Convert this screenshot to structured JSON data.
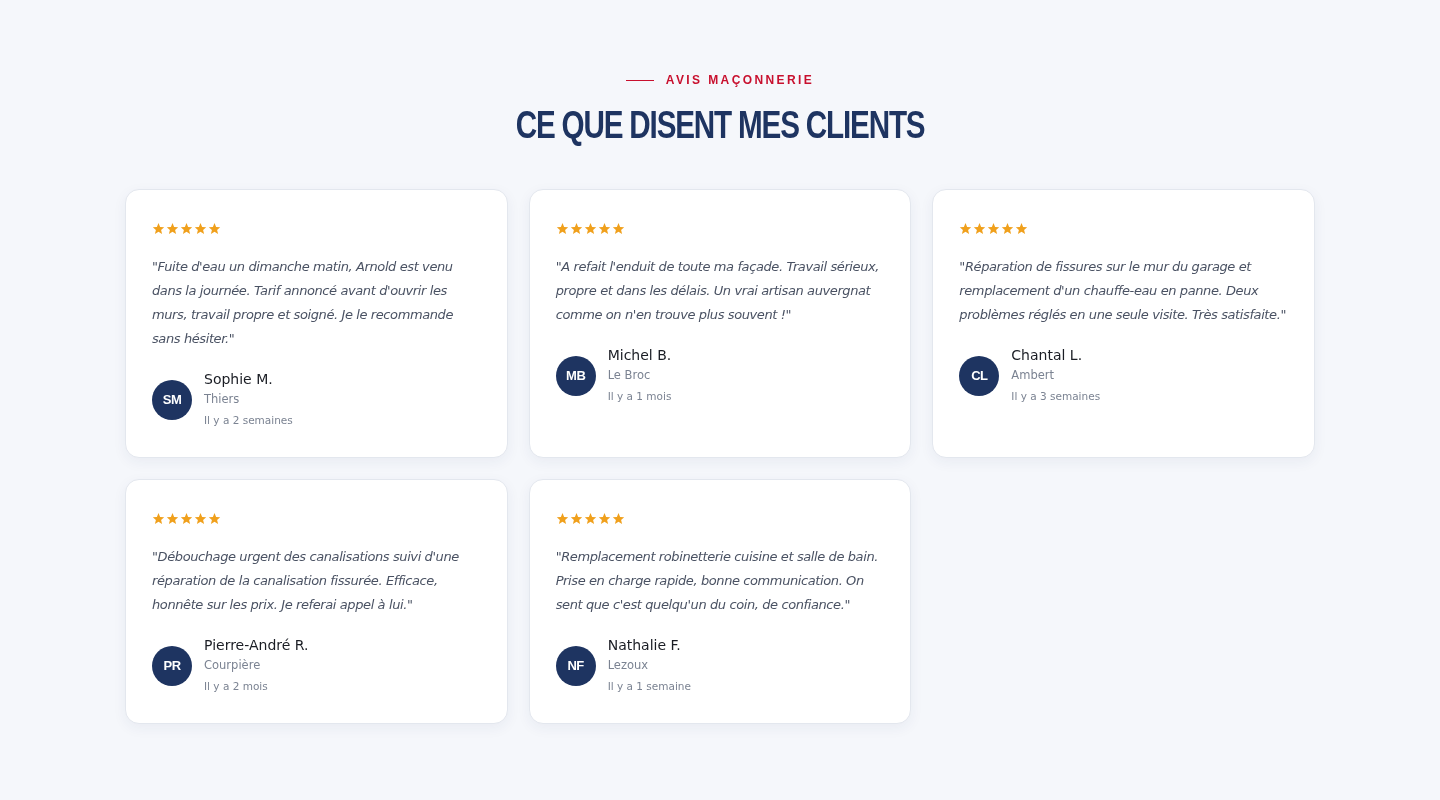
{
  "section": {
    "eyebrow": "AVIS MAÇONNERIE",
    "title": "CE QUE DISENT MES CLIENTS"
  },
  "reviews": [
    {
      "stars": 5,
      "quote": "\"Fuite d'eau un dimanche matin, Arnold est venu dans la journée. Tarif annoncé avant d'ouvrir les murs, travail propre et soigné. Je le recommande sans hésiter.\"",
      "initials": "SM",
      "name": "Sophie M.",
      "city": "Thiers",
      "date": "Il y a 2 semaines"
    },
    {
      "stars": 5,
      "quote": "\"A refait l'enduit de toute ma façade. Travail sérieux, propre et dans les délais. Un vrai artisan auvergnat comme on n'en trouve plus souvent !\"",
      "initials": "MB",
      "name": "Michel B.",
      "city": "Le Broc",
      "date": "Il y a 1 mois"
    },
    {
      "stars": 5,
      "quote": "\"Réparation de fissures sur le mur du garage et remplacement d'un chauffe-eau en panne. Deux problèmes réglés en une seule visite. Très satisfaite.\"",
      "initials": "CL",
      "name": "Chantal L.",
      "city": "Ambert",
      "date": "Il y a 3 semaines"
    },
    {
      "stars": 5,
      "quote": "\"Débouchage urgent des canalisations suivi d'une réparation de la canalisation fissurée. Efficace, honnête sur les prix. Je referai appel à lui.\"",
      "initials": "PR",
      "name": "Pierre-André R.",
      "city": "Courpière",
      "date": "Il y a 2 mois"
    },
    {
      "stars": 5,
      "quote": "\"Remplacement robinetterie cuisine et salle de bain. Prise en charge rapide, bonne communication. On sent que c'est quelqu'un du coin, de confiance.\"",
      "initials": "NF",
      "name": "Nathalie F.",
      "city": "Lezoux",
      "date": "Il y a 1 semaine"
    }
  ]
}
